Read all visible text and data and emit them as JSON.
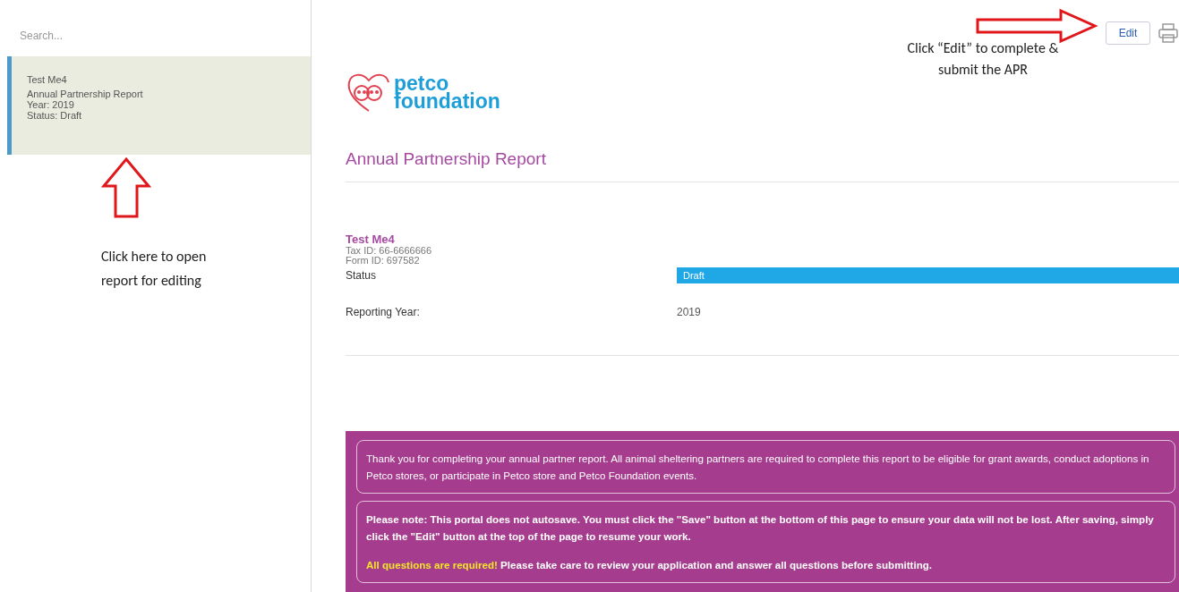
{
  "sidebar": {
    "search": {
      "placeholder": "Search..."
    },
    "items": [
      {
        "selected": true,
        "lines": [
          "Test Me4",
          "Annual Partnership Report",
          "Year: 2019",
          "Status: Draft"
        ]
      }
    ]
  },
  "annotations": [
    {
      "kind": "up",
      "text": "Click here to open report for editing"
    },
    {
      "kind": "right",
      "text": "Click “Edit” to complete & submit the APR"
    }
  ],
  "toolbar": {
    "edit_button": "Edit"
  },
  "logo": {
    "line_1": "petco",
    "line_2": "foundation"
  },
  "report": {
    "title": "Annual Partnership Report",
    "organization": "Test Me4",
    "tax_id": "Tax ID: 66-6666666",
    "form_id": "Form ID: 697582",
    "fields": [
      {
        "kind": "badge",
        "label": "Status",
        "value": "Draft"
      },
      {
        "kind": "text",
        "label": "Reporting Year:",
        "value": "2019"
      }
    ]
  },
  "notices": [
    {
      "paragraphs": [
        {
          "text": "Thank you for completing your annual partner report. All animal sheltering partners are required to complete this report to be eligible for grant awards, conduct adoptions in Petco stores, or participate in Petco store and Petco Foundation events."
        }
      ],
      "bold": false
    },
    {
      "paragraphs": [
        {
          "text": "Please note: This portal does not autosave. You must click the \"Save\" button at the bottom of this page to ensure your data will not be lost. After saving, simply click the \"Edit\" button at the top of the page to resume your work."
        },
        {
          "highlight": "All questions are required!",
          "text": " Please take care to review your application and answer all questions before submitting."
        }
      ],
      "bold": true
    }
  ]
}
